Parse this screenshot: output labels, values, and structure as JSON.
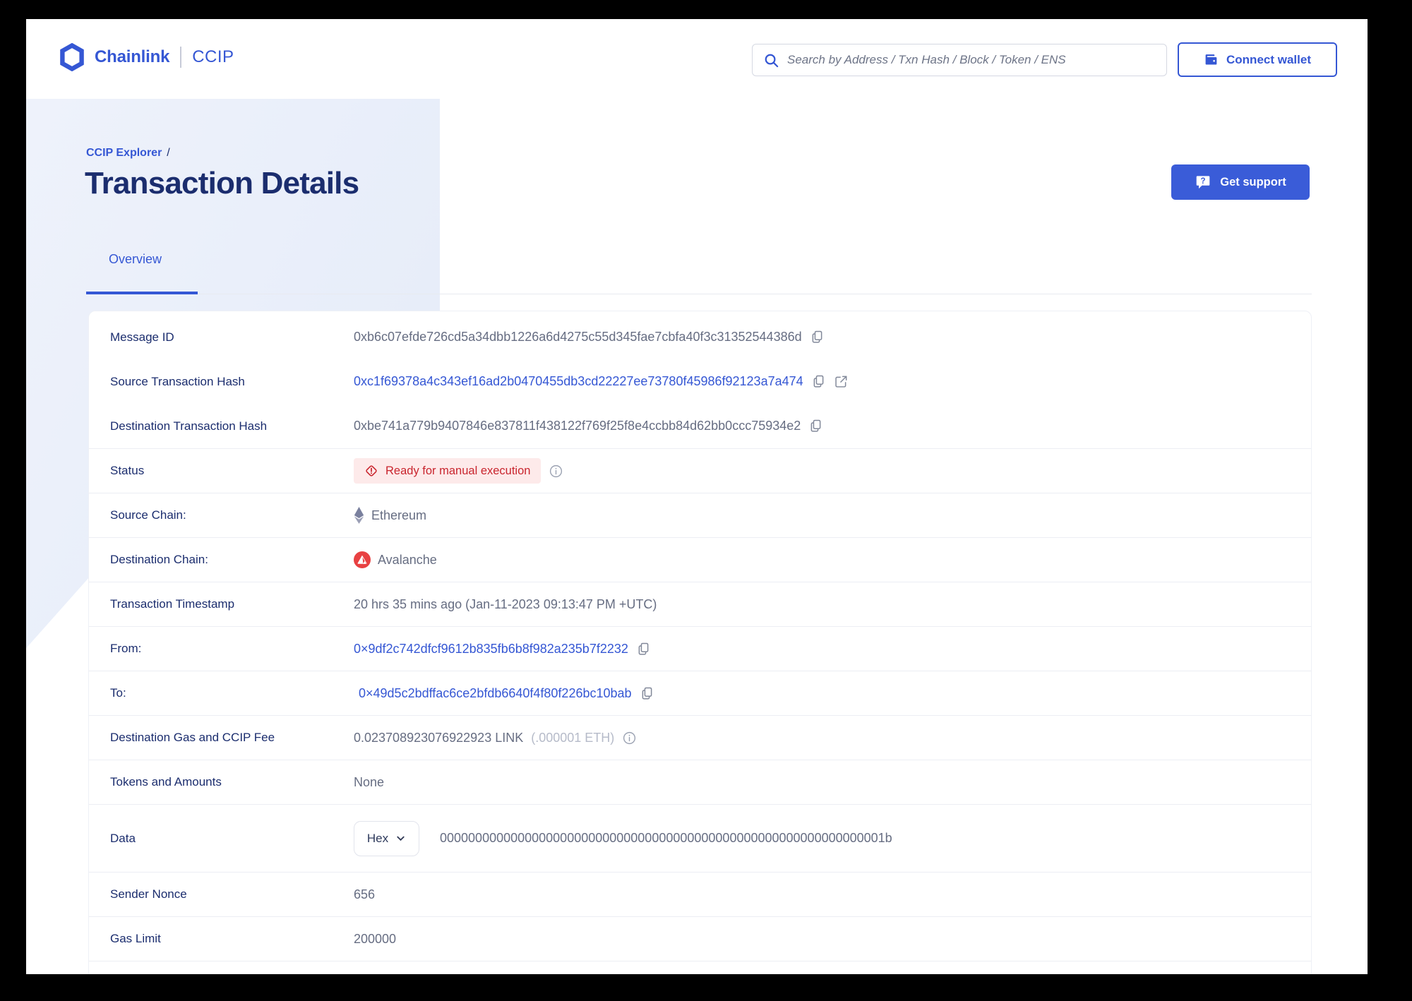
{
  "colors": {
    "brand_blue": "#3557d4",
    "navy": "#1b2d6e",
    "value_gray": "#666d82",
    "status_red": "#c9252e",
    "status_bg": "#fdeaea",
    "button_blue": "#3a5cd8",
    "ethereum_gray": "#6f7596",
    "avalanche_red": "#e84142"
  },
  "header": {
    "brand": "Chainlink",
    "product": "CCIP",
    "search_placeholder": "Search by Address / Txn Hash / Block / Token / ENS",
    "connect_wallet_label": "Connect wallet"
  },
  "hero": {
    "breadcrumb": "CCIP Explorer",
    "breadcrumb_separator": "/",
    "title": "Transaction Details",
    "get_support_label": "Get support",
    "tab_label": "Overview"
  },
  "details": {
    "message_id": {
      "label": "Message ID",
      "value": "0xb6c07efde726cd5a34dbb1226a6d4275c55d345fae7cbfa40f3c31352544386d"
    },
    "source_tx_hash": {
      "label": "Source Transaction Hash",
      "value": "0xc1f69378a4c343ef16ad2b0470455db3cd22227ee73780f45986f92123a7a474"
    },
    "dest_tx_hash": {
      "label": "Destination Transaction Hash",
      "value": "0xbe741a779b9407846e837811f438122f769f25f8e4ccbb84d62bb0ccc75934e2"
    },
    "status": {
      "label": "Status",
      "value": "Ready for manual execution"
    },
    "source_chain": {
      "label": "Source Chain:",
      "value": "Ethereum"
    },
    "dest_chain": {
      "label": "Destination Chain:",
      "value": "Avalanche"
    },
    "timestamp": {
      "label": "Transaction Timestamp",
      "value": "20 hrs 35 mins ago (Jan-11-2023 09:13:47 PM +UTC)"
    },
    "from": {
      "label": "From:",
      "value": "0×9df2c742dfcf9612b835fb6b8f982a235b7f2232"
    },
    "to": {
      "label": "To:",
      "value": "0×49d5c2bdffac6ce2bfdb6640f4f80f226bc10bab"
    },
    "fee": {
      "label": "Destination Gas and CCIP Fee",
      "value": "0.023708923076922923 LINK",
      "alt_value": "(.000001 ETH)"
    },
    "tokens": {
      "label": "Tokens and Amounts",
      "value": "None"
    },
    "data": {
      "label": "Data",
      "format": "Hex",
      "value": "000000000000000000000000000000000000000000000000000000000000001b"
    },
    "sender_nonce": {
      "label": "Sender Nonce",
      "value": "656"
    },
    "gas_limit": {
      "label": "Gas Limit",
      "value": "200000"
    }
  },
  "icons": {
    "chainlink-logo-icon": "hexagon-outline",
    "search-icon": "magnifier",
    "wallet-icon": "wallet",
    "question-icon": "question-speech-bubble",
    "copy-icon": "overlapping-pages",
    "external-link-icon": "arrow-out-of-box",
    "alert-diamond-icon": "diamond-exclamation",
    "info-icon": "circled-i",
    "ethereum-icon": "eth-diamond",
    "avalanche-icon": "avax-triangle-in-circle",
    "chevron-down-icon": "chevron-down"
  }
}
